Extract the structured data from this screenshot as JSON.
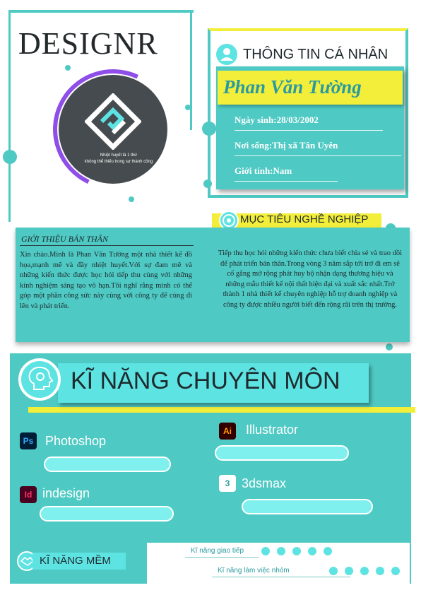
{
  "brand": "DESIGNR",
  "logo_tagline": [
    "Nhiệt huyết là 1 thứ",
    "không thể thiếu trong sự thành công"
  ],
  "personal_info": {
    "heading": "THÔNG TIN CÁ NHÂN",
    "name": "Phan Văn Tường",
    "birth": "Ngày sinh:28/03/2002",
    "residence": "Nơi sống:Thị xã Tân Uyên",
    "gender": "Giới tính:Nam"
  },
  "career_goal": {
    "heading": "MỤC TIÊU NGHỀ NGHIỆP",
    "text": "Tiếp thu học hỏi những kiến thức chưa biết chia sẻ và trao dồi để phát triển bản thân.Trong vòng 3 năm sắp tới trở đi em sẽ cố gắng mở rộng phát huy bộ nhận dạng thương hiệu và những mẫu thiết kế nội thất hiện đại và xuất sắc nhất.Trở thành 1 nhà thiết kế chuyên nghiệp  hỗ trợ doanh nghiệp và công ty được nhiều người biết đến rộng rãi trên thị trường."
  },
  "intro": {
    "heading": "GIỚI THIỆU BẢN THÂN",
    "text": "Xin chào.Mình là Phan Văn Tường một nhà thiết kế đồ họa,mạnh mẽ và đầy nhiệt huyết.Với sự đam mê và những kiến thức được học hỏi tiếp thu cùng với những kinh nghiệm sáng tạo vô hạn.Tôi nghĩ rằng mình có thể góp một phần công sức này cùng với công ty để cùng đi lên và phát triển."
  },
  "skills": {
    "heading": "KĨ NĂNG CHUYÊN MÔN",
    "items": [
      {
        "icon": "Ps",
        "label": "Photoshop",
        "icon_bg": "#001e36",
        "icon_fg": "#31a8ff",
        "level": 0.8
      },
      {
        "icon": "Ai",
        "label": "Illustrator",
        "icon_bg": "#330000",
        "icon_fg": "#ff9a00",
        "level": 0.75
      },
      {
        "icon": "Id",
        "label": "indesign",
        "icon_bg": "#49021f",
        "icon_fg": "#ff3366",
        "level": 0.8
      },
      {
        "icon": "3",
        "label": "3dsmax",
        "icon_bg": "#ffffff",
        "icon_fg": "#2aa39d",
        "level": 0.85
      }
    ]
  },
  "soft_skills": {
    "heading": "KĨ NĂNG MỀM",
    "items": [
      {
        "label": "Kĩ năng giao tiếp",
        "dots": 5
      },
      {
        "label": "Kĩ năng làm việc nhóm",
        "dots": 5
      }
    ]
  },
  "colors": {
    "teal": "#4ec9c3",
    "light_teal": "#5ee3e3",
    "yellow": "#f2ee3a",
    "dark": "#454b4e"
  }
}
